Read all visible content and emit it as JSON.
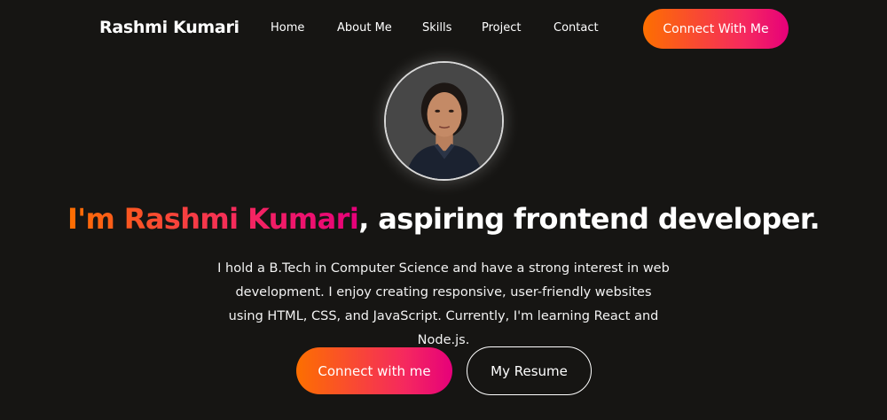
{
  "nav": {
    "logo": "Rashmi Kumari",
    "links": [
      "Home",
      "About Me",
      "Skills",
      "Project",
      "Contact"
    ],
    "cta_label": "Connect With Me"
  },
  "hero": {
    "name_highlight": "I'm Rashmi Kumari",
    "headline_rest": ", aspiring frontend developer.",
    "bio": "I hold a B.Tech in Computer Science and have a strong interest in web development. I enjoy creating responsive, user-friendly websites using HTML, CSS, and JavaScript. Currently, I'm learning React and Node.js.",
    "primary_button": "Connect with me",
    "secondary_button": "My Resume"
  },
  "colors": {
    "background": "#161513",
    "accent_start": "#fd6f00",
    "accent_end": "#e6007a",
    "text": "#ffffff"
  }
}
